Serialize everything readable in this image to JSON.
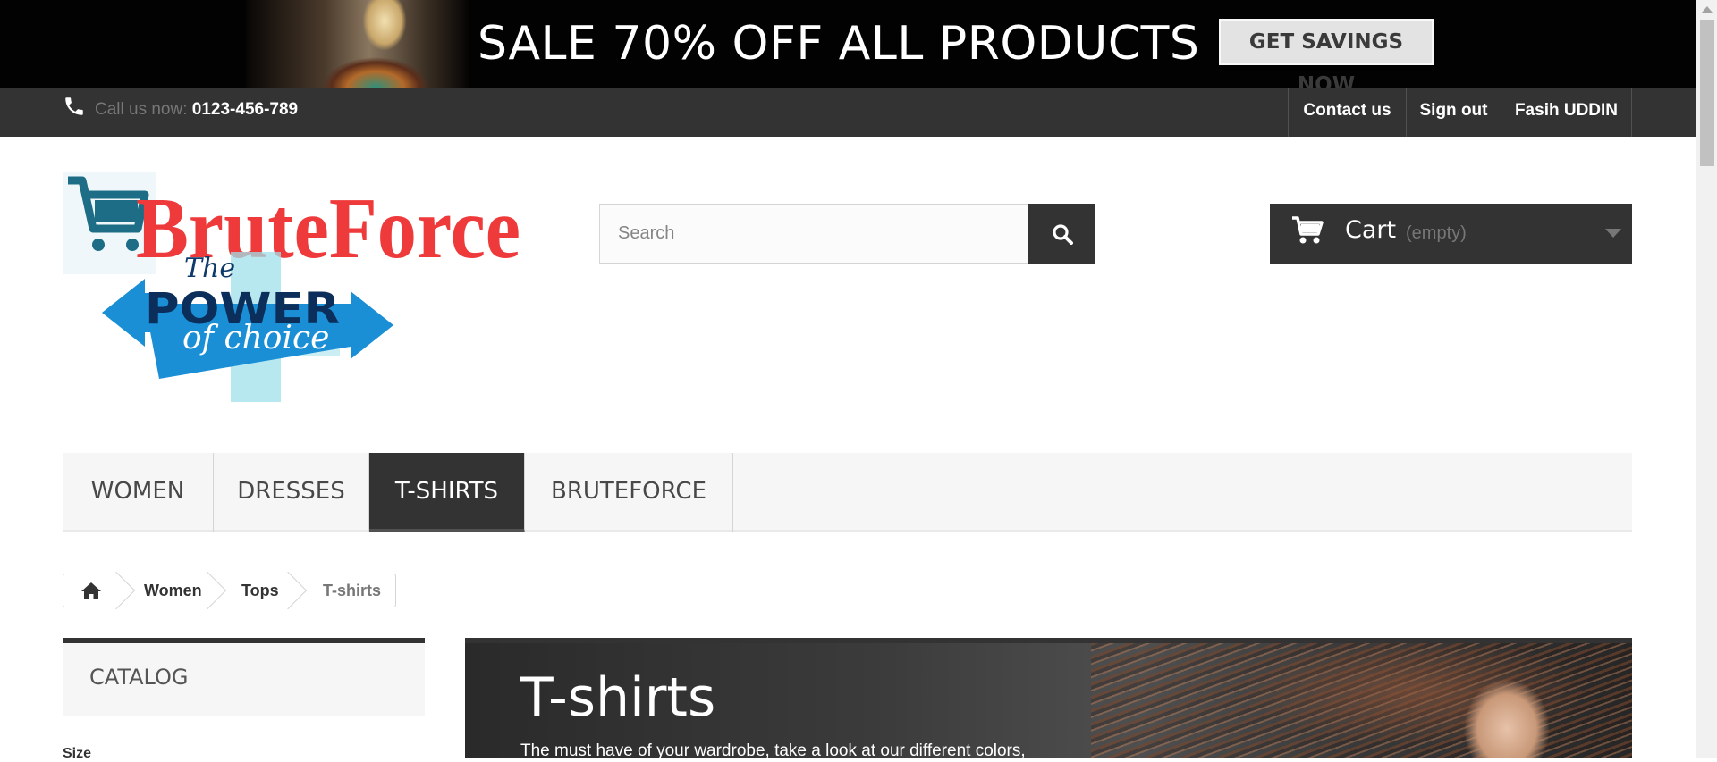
{
  "banner": {
    "headline": "SALE 70% OFF ALL PRODUCTS",
    "cta_label": "GET SAVINGS NOW"
  },
  "topbar": {
    "call_label": "Call us now:",
    "phone": "0123-456-789",
    "links": {
      "contact": "Contact us",
      "signout": "Sign out",
      "account": "Fasih UDDIN"
    }
  },
  "logo": {
    "brand": "BruteForce",
    "tag_the": "The",
    "tag_power": "POWER",
    "tag_choice": "of choice",
    "colors": {
      "brand_red": "#ee3a3a",
      "cart_teal": "#1e6d86",
      "arrow_blue": "#1a8fd6",
      "cross_cyan": "#9fe0ea"
    }
  },
  "search": {
    "placeholder": "Search",
    "icon": "search-icon"
  },
  "cart": {
    "label": "Cart",
    "status": "(empty)",
    "icon": "cart-icon"
  },
  "menu": {
    "items": [
      {
        "label": "WOMEN",
        "active": false
      },
      {
        "label": "DRESSES",
        "active": false
      },
      {
        "label": "T-SHIRTS",
        "active": true
      },
      {
        "label": "BRUTEFORCE",
        "active": false
      }
    ]
  },
  "breadcrumb": {
    "items": [
      "Women",
      "Tops",
      "T-shirts"
    ],
    "home_icon": "home-icon"
  },
  "sidebar": {
    "catalog_title": "CATALOG",
    "filter_label": "Size"
  },
  "category": {
    "title": "T-shirts",
    "description": "The must have of your wardrobe, take a look at our different colors,"
  },
  "colors": {
    "dark": "#333333",
    "menu_bg": "#f6f6f6",
    "muted": "#777777"
  }
}
